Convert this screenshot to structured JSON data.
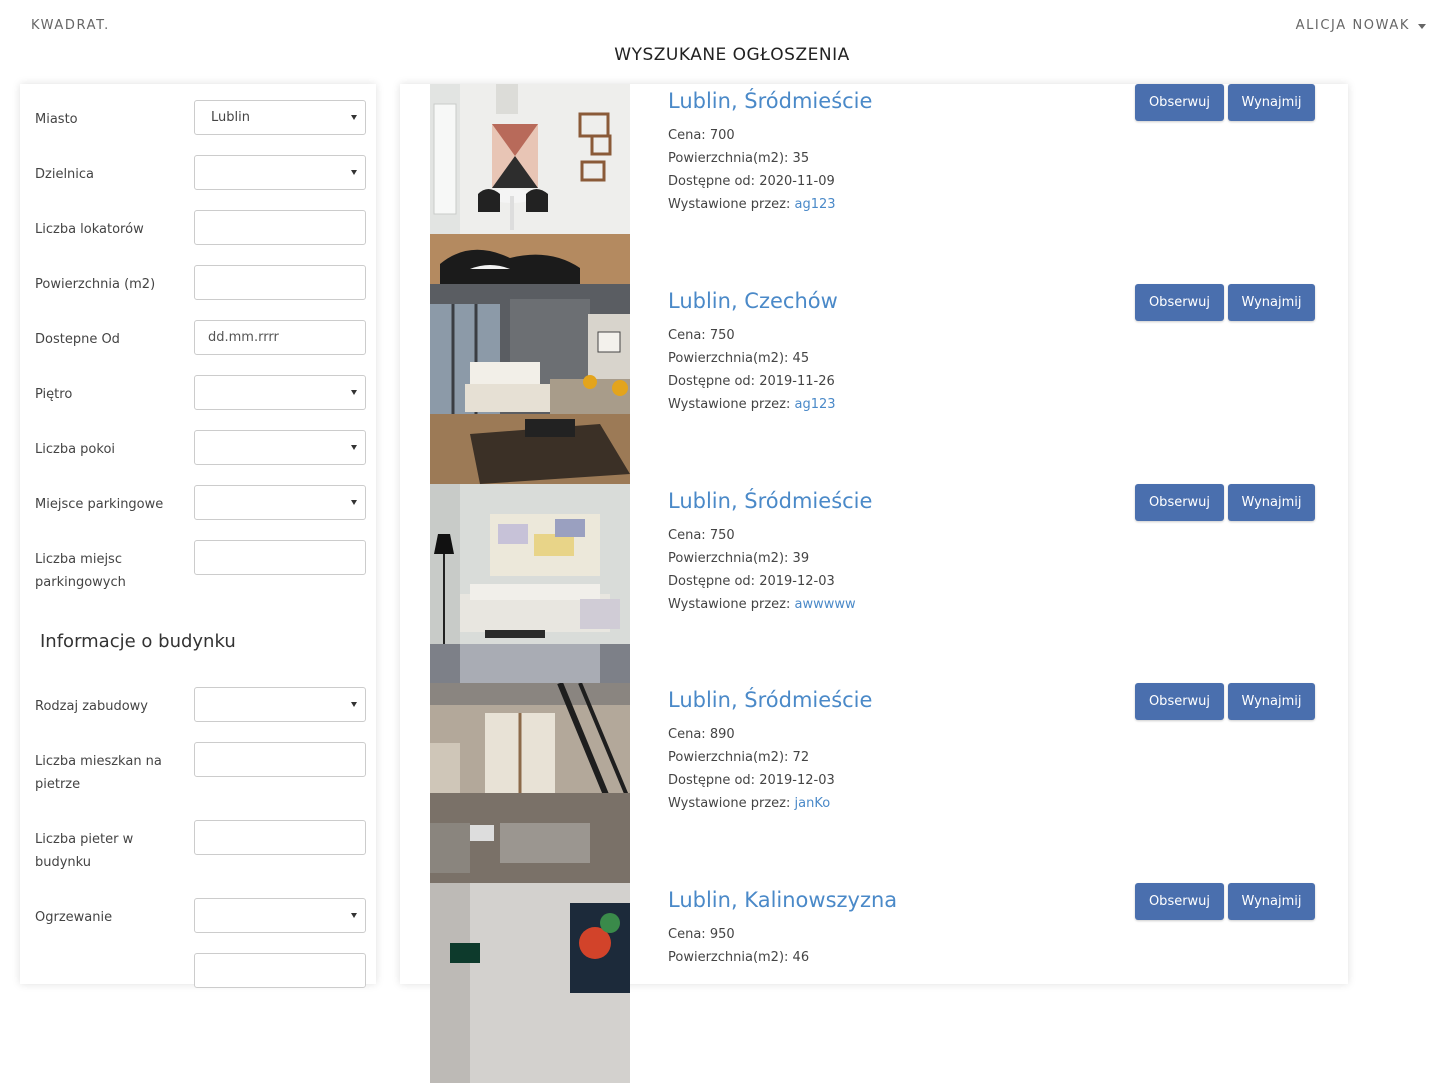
{
  "header": {
    "brand": "KWADRAT.",
    "user": "ALICJA NOWAK",
    "page_title": "WYSZUKANE OGŁOSZENIA"
  },
  "filters": {
    "city_label": "Miasto",
    "city_value": "Lublin",
    "district_label": "Dzielnica",
    "tenants_label": "Liczba lokatorów",
    "area_label": "Powierzchnia (m2)",
    "available_label": "Dostepne Od",
    "available_placeholder": "dd.mm.rrrr",
    "floor_label": "Piętro",
    "rooms_label": "Liczba pokoi",
    "parking_label": "Miejsce parkingowe",
    "parking_count_label": "Liczba miejsc parkingowych",
    "building_section": "Informacje o budynku",
    "building_type_label": "Rodzaj zabudowy",
    "flats_per_floor_label": "Liczba mieszkan na pietrze",
    "floors_in_building_label": "Liczba pieter w budynku",
    "heating_label": "Ogrzewanie"
  },
  "listing_labels": {
    "price": "Cena:",
    "area": "Powierzchnia(m2):",
    "available": "Dostępne od:",
    "posted_by": "Wystawione przez:",
    "watch": "Obserwuj",
    "rent": "Wynajmij"
  },
  "listings": [
    {
      "title": "Lublin, Śródmieście",
      "price": "700",
      "area": "35",
      "available": "2020-11-09",
      "owner": "ag123"
    },
    {
      "title": "Lublin, Czechów",
      "price": "750",
      "area": "45",
      "available": "2019-11-26",
      "owner": "ag123"
    },
    {
      "title": "Lublin, Śródmieście",
      "price": "750",
      "area": "39",
      "available": "2019-12-03",
      "owner": "awwwww"
    },
    {
      "title": "Lublin, Śródmieście",
      "price": "890",
      "area": "72",
      "available": "2019-12-03",
      "owner": "janKo"
    },
    {
      "title": "Lublin, Kalinowszyzna",
      "price": "950",
      "area": "46",
      "available": "",
      "owner": ""
    }
  ]
}
